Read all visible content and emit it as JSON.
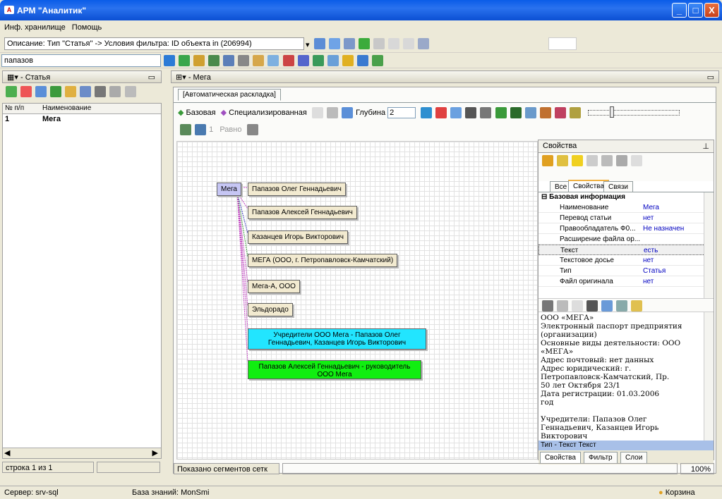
{
  "window": {
    "title": "АРМ \"Аналитик\"",
    "min": "_",
    "max": "□",
    "close": "X"
  },
  "menu": [
    "Инф. хранилище",
    "Помощь"
  ],
  "toolbar": {
    "description_label": "Описание:",
    "description_value": "Тип \"Статья\" -> Условия фильтра: ID объекта in (206994)",
    "search_value": "папазов"
  },
  "left_panel": {
    "title": "- Статья",
    "columns": [
      "№ п/п",
      "Наименование"
    ],
    "rows": [
      {
        "num": "1",
        "name": "Мега"
      }
    ],
    "status": "строка 1 из 1"
  },
  "main_panel": {
    "title": "- Мега",
    "tab": "[Автоматическая раскладка]",
    "btn_base": "Базовая",
    "btn_special": "Специализированная",
    "depth_label": "Глубина",
    "depth_value": "2",
    "layer_value": "1",
    "align_label": "Равно",
    "status": "Показано сегментов сетк",
    "zoom": "100%"
  },
  "graph": {
    "root": "Мега",
    "nodes": [
      "Папазов Олег Геннадьевич",
      "Папазов Алексей Геннадьевич",
      "Казанцев Игорь Викторович",
      "МЕГА (ООО, г. Петропавловск-Камчатский)",
      "Мега-А, ООО",
      "Эльдорадо",
      "Учредители ООО  Мега  - Папазов Олег Геннадьевич, Казанцев Игорь Викторович",
      "Папазов Алексей Геннадьевич - руководитель ООО Мега"
    ],
    "colors": {
      "founders": "#22e5ff",
      "leader": "#11ee11",
      "node": "#f2ead0",
      "root": "#c6c6f4"
    }
  },
  "properties": {
    "title": "Свойства",
    "tabs": [
      "Все",
      "Свойства",
      "Связи"
    ],
    "section": "Базовая информация",
    "rows": [
      {
        "k": "Наименование",
        "v": "Мега"
      },
      {
        "k": "Перевод статьи",
        "v": "нет"
      },
      {
        "k": "Правообладатель Ф0...",
        "v": "Не назначен"
      },
      {
        "k": "Расширение файла ор...",
        "v": ""
      },
      {
        "k": "Текст",
        "v": "есть"
      },
      {
        "k": "Текстовое досье",
        "v": "нет"
      },
      {
        "k": "Тип",
        "v": "Статья"
      },
      {
        "k": "Файл оригинала",
        "v": "нет"
      }
    ],
    "text_lines": [
      "ООО «МЕГА»",
      "Электронный паспорт предприятия",
      "(организации)",
      "Основные виды деятельности: ООО",
      "«МЕГА»",
      "Адрес почтовый: нет данных",
      "Адрес юридический: г.",
      "Петропавловск-Камчатский, Пр.",
      "50 лет Октября 23/1",
      "Дата регистрации: 01.03.2006",
      "год",
      "",
      "Учредители: Папазов Олег",
      "Геннадьевич, Казанцев Игорь",
      "Викторович"
    ],
    "type_line": "Тип - Текст  Текст",
    "bottom_tabs": [
      "Свойства",
      "Фильтр",
      "Слои"
    ]
  },
  "statusbar": {
    "server": "Сервер: srv-sql",
    "kb": "База знаний: MonSmi",
    "basket": "Корзина"
  }
}
